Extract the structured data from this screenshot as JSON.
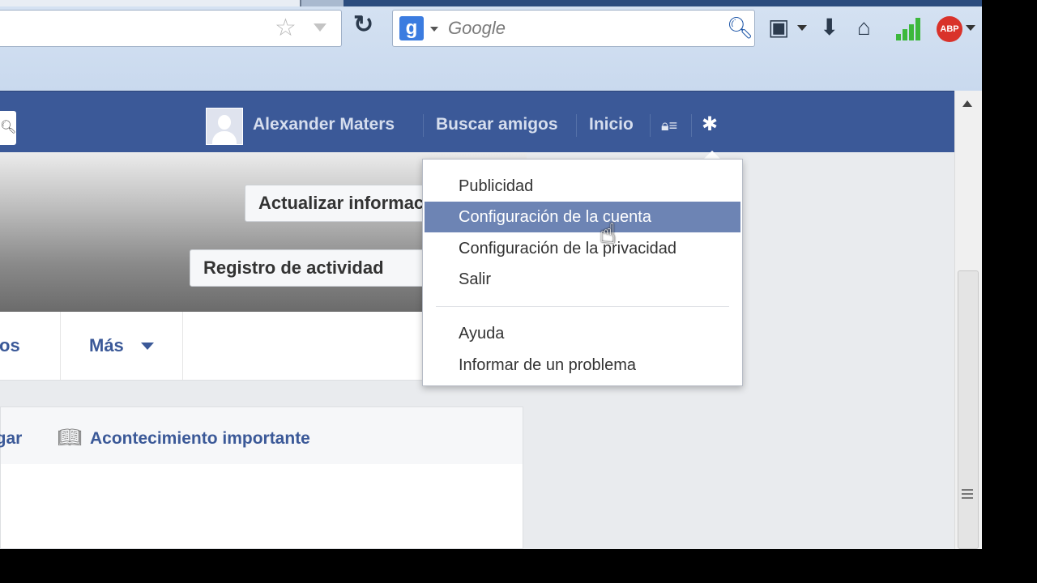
{
  "browser": {
    "search_placeholder": "Google",
    "search_engine_letter": "g",
    "adblock_label": "ABP",
    "icons": [
      "star-icon",
      "reload-icon",
      "search-icon",
      "bookmark-icon",
      "download-icon",
      "home-icon",
      "signal-icon",
      "adblock-icon"
    ]
  },
  "topbar": {
    "user_name": "Alexander Maters",
    "find_friends": "Buscar amigos",
    "home": "Inicio",
    "accent_color": "#3b5998"
  },
  "cover": {
    "update_info_label": "Actualizar información",
    "activity_log_label": "Registro de actividad"
  },
  "tabs": {
    "friends_label": "Amigos",
    "more_label": "Más"
  },
  "composer": {
    "place_label": "Lugar",
    "life_event_label": "Acontecimiento importante"
  },
  "settings_menu": {
    "items": [
      {
        "label": "Publicidad"
      },
      {
        "label": "Configuración de la cuenta",
        "highlighted": true
      },
      {
        "label": "Configuración de la privacidad"
      },
      {
        "label": "Salir"
      },
      {
        "label": "Ayuda"
      },
      {
        "label": "Informar de un problema"
      }
    ],
    "highlight_color": "#6d84b4"
  }
}
